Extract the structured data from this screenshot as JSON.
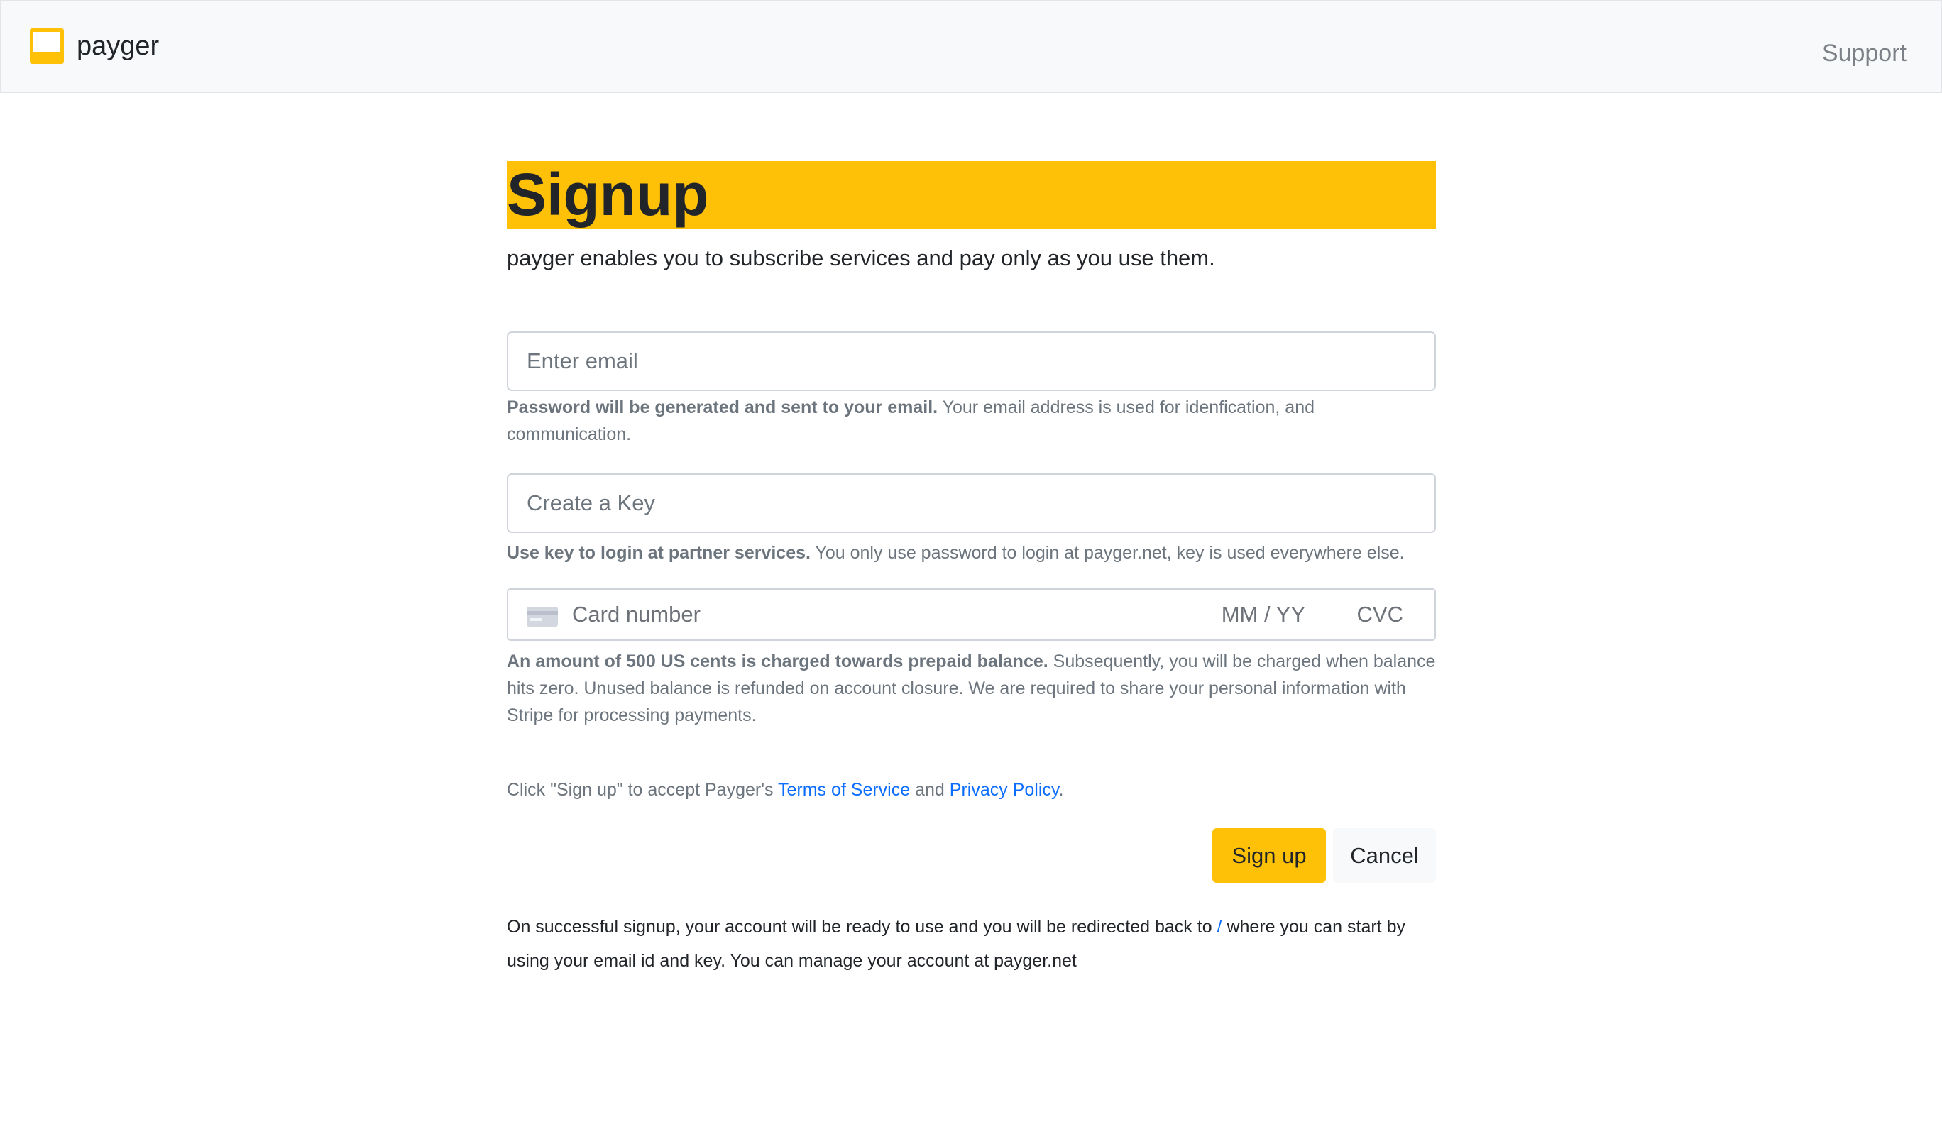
{
  "colors": {
    "accent": "#ffc107",
    "link": "#0d6efd",
    "muted": "#6c757d"
  },
  "navbar": {
    "brand": "payger",
    "brand_icon": "payger-logo-icon",
    "support": "Support"
  },
  "header": {
    "title": "Signup",
    "tagline": "payger enables you to subscribe services and pay only as you use them."
  },
  "form": {
    "email": {
      "placeholder": "Enter email",
      "value": "",
      "help_bold": "Password will be generated and sent to your email.",
      "help_text": "Your email address is used for idenfication, and communication."
    },
    "key": {
      "placeholder": "Create a Key",
      "value": "",
      "help_bold": "Use key to login at partner services.",
      "help_text": "You only use password to login at payger.net, key is used everywhere else."
    },
    "card": {
      "icon": "credit-card-icon",
      "number_placeholder": "Card number",
      "expiry_placeholder": "MM / YY",
      "cvc_placeholder": "CVC",
      "help_bold": "An amount of 500 US cents is charged towards prepaid balance.",
      "help_text": "Subsequently, you will be charged when balance hits zero. Unused balance is refunded on account closure. We are required to share your personal information with Stripe for processing payments."
    }
  },
  "terms": {
    "prefix": "Click \"Sign up\" to accept Payger's",
    "tos_link": "Terms of Service",
    "and": "and",
    "privacy_link": "Privacy Policy",
    "suffix": "."
  },
  "actions": {
    "signup": "Sign up",
    "cancel": "Cancel"
  },
  "footer": {
    "text_before": "On successful signup, your account will be ready to use and you will be redirected back to",
    "redirect_link": "/",
    "text_after": "where you can start by using your email id and key. You can manage your account at payger.net"
  }
}
